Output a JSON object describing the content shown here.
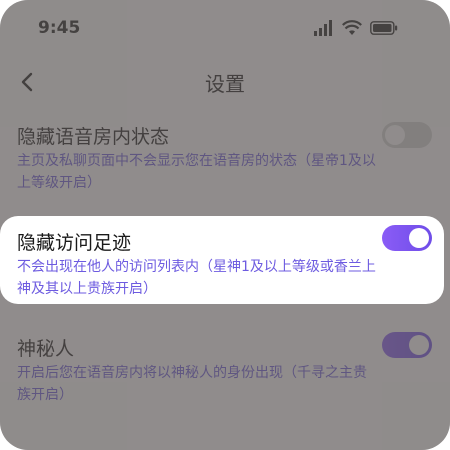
{
  "status": {
    "time": "9:45"
  },
  "nav": {
    "title": "设置"
  },
  "settings": [
    {
      "title": "隐藏语音房内状态",
      "desc": "主页及私聊页面中不会显示您在语音房的状态（星帝1及以上等级开启）",
      "enabled": false
    },
    {
      "title": "隐藏访问足迹",
      "desc": "不会出现在他人的访问列表内（星神1及以上等级或香兰上神及其以上贵族开启）",
      "enabled": true
    },
    {
      "title": "神秘人",
      "desc": "开启后您在语音房内将以神秘人的身份出现（千寻之主贵族开启）",
      "enabled": true
    }
  ],
  "colors": {
    "overlay": "#595453",
    "accent": "#7b55ef",
    "desc_text": "#6d5be0",
    "toggle_off": "#d6d6d6"
  }
}
